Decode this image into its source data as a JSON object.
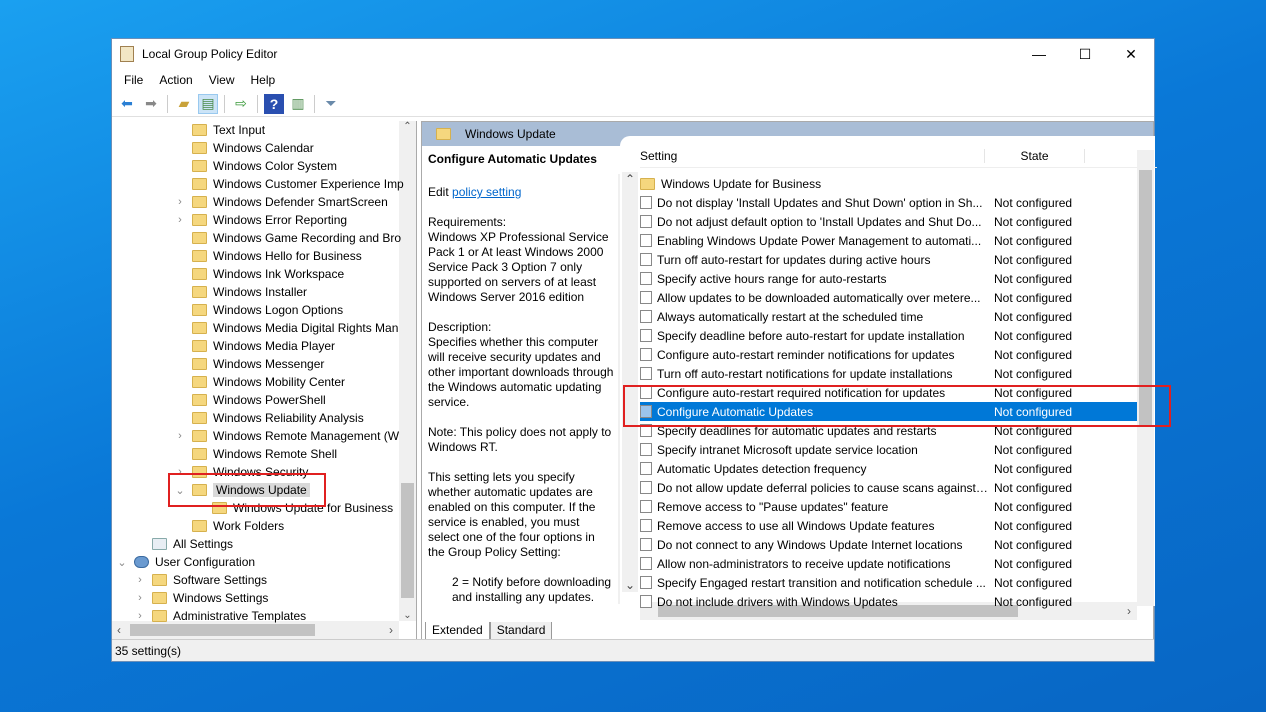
{
  "window": {
    "title": "Local Group Policy Editor",
    "minimize": "—",
    "maximize": "☐",
    "close": "✕"
  },
  "menu": [
    "File",
    "Action",
    "View",
    "Help"
  ],
  "tree": [
    {
      "label": "Text Input",
      "level": 2,
      "chev": ""
    },
    {
      "label": "Windows Calendar",
      "level": 2,
      "chev": ""
    },
    {
      "label": "Windows Color System",
      "level": 2,
      "chev": ""
    },
    {
      "label": "Windows Customer Experience Imp",
      "level": 2,
      "chev": ""
    },
    {
      "label": "Windows Defender SmartScreen",
      "level": 2,
      "chev": "›"
    },
    {
      "label": "Windows Error Reporting",
      "level": 2,
      "chev": "›"
    },
    {
      "label": "Windows Game Recording and Bro",
      "level": 2,
      "chev": ""
    },
    {
      "label": "Windows Hello for Business",
      "level": 2,
      "chev": ""
    },
    {
      "label": "Windows Ink Workspace",
      "level": 2,
      "chev": ""
    },
    {
      "label": "Windows Installer",
      "level": 2,
      "chev": ""
    },
    {
      "label": "Windows Logon Options",
      "level": 2,
      "chev": ""
    },
    {
      "label": "Windows Media Digital Rights Man",
      "level": 2,
      "chev": ""
    },
    {
      "label": "Windows Media Player",
      "level": 2,
      "chev": ""
    },
    {
      "label": "Windows Messenger",
      "level": 2,
      "chev": ""
    },
    {
      "label": "Windows Mobility Center",
      "level": 2,
      "chev": ""
    },
    {
      "label": "Windows PowerShell",
      "level": 2,
      "chev": ""
    },
    {
      "label": "Windows Reliability Analysis",
      "level": 2,
      "chev": ""
    },
    {
      "label": "Windows Remote Management (W",
      "level": 2,
      "chev": "›"
    },
    {
      "label": "Windows Remote Shell",
      "level": 2,
      "chev": ""
    },
    {
      "label": "Windows Security",
      "level": 2,
      "chev": "›"
    },
    {
      "label": "Windows Update",
      "level": 2,
      "chev": "⌄",
      "selected": true
    },
    {
      "label": "Windows Update for Business",
      "level": 3,
      "chev": ""
    },
    {
      "label": "Work Folders",
      "level": 2,
      "chev": ""
    },
    {
      "label": "All Settings",
      "level": 1,
      "chev": "",
      "icon": "settings"
    },
    {
      "label": "User Configuration",
      "level": 0,
      "chev": "⌄",
      "icon": "user"
    },
    {
      "label": "Software Settings",
      "level": 1,
      "chev": "›"
    },
    {
      "label": "Windows Settings",
      "level": 1,
      "chev": "›"
    },
    {
      "label": "Administrative Templates",
      "level": 1,
      "chev": "›"
    }
  ],
  "header": {
    "title": "Windows Update"
  },
  "description": {
    "title": "Configure Automatic Updates",
    "edit_prefix": "Edit ",
    "edit_link": "policy setting ",
    "requirements": "Requirements:\nWindows XP Professional Service Pack 1 or At least Windows 2000 Service Pack 3 Option 7 only supported on servers of at least Windows Server 2016 edition",
    "description": "Description:\nSpecifies whether this computer will receive security updates and other important downloads through the Windows automatic updating service.",
    "note": "Note: This policy does not apply to Windows RT.",
    "body": "This setting lets you specify whether automatic updates are enabled on this computer. If the service is enabled, you must select one of the four options in the Group Policy Setting:",
    "option2": "2 = Notify before downloading and installing any updates."
  },
  "list": {
    "col_setting": "Setting",
    "col_state": "State",
    "rows": [
      {
        "name": "Windows Update for Business",
        "state": "",
        "folder": true
      },
      {
        "name": "Do not display 'Install Updates and Shut Down' option in Sh...",
        "state": "Not configured"
      },
      {
        "name": "Do not adjust default option to 'Install Updates and Shut Do...",
        "state": "Not configured"
      },
      {
        "name": "Enabling Windows Update Power Management to automati...",
        "state": "Not configured"
      },
      {
        "name": "Turn off auto-restart for updates during active hours",
        "state": "Not configured"
      },
      {
        "name": "Specify active hours range for auto-restarts",
        "state": "Not configured"
      },
      {
        "name": "Allow updates to be downloaded automatically over metere...",
        "state": "Not configured"
      },
      {
        "name": "Always automatically restart at the scheduled time",
        "state": "Not configured"
      },
      {
        "name": "Specify deadline before auto-restart for update installation",
        "state": "Not configured"
      },
      {
        "name": "Configure auto-restart reminder notifications for updates",
        "state": "Not configured"
      },
      {
        "name": "Turn off auto-restart notifications for update installations",
        "state": "Not configured"
      },
      {
        "name": "Configure auto-restart required notification for updates",
        "state": "Not configured"
      },
      {
        "name": "Configure Automatic Updates",
        "state": "Not configured",
        "selected": true
      },
      {
        "name": "Specify deadlines for automatic updates and restarts",
        "state": "Not configured"
      },
      {
        "name": "Specify intranet Microsoft update service location",
        "state": "Not configured"
      },
      {
        "name": "Automatic Updates detection frequency",
        "state": "Not configured"
      },
      {
        "name": "Do not allow update deferral policies to cause scans against ...",
        "state": "Not configured"
      },
      {
        "name": "Remove access to \"Pause updates\" feature",
        "state": "Not configured"
      },
      {
        "name": "Remove access to use all Windows Update features",
        "state": "Not configured"
      },
      {
        "name": "Do not connect to any Windows Update Internet locations",
        "state": "Not configured"
      },
      {
        "name": "Allow non-administrators to receive update notifications",
        "state": "Not configured"
      },
      {
        "name": "Specify Engaged restart transition and notification schedule ...",
        "state": "Not configured"
      },
      {
        "name": "Do not include drivers with Windows Updates",
        "state": "Not configured"
      }
    ]
  },
  "tabs": [
    "Extended",
    "Standard"
  ],
  "status": "35 setting(s)",
  "colors": {
    "selection": "#0078d7",
    "header": "#a9bdd6",
    "highlight": "#e02020"
  }
}
